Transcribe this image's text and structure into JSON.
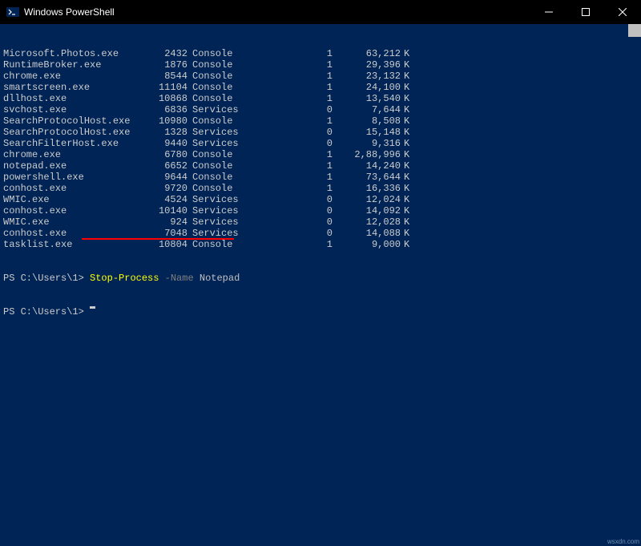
{
  "window": {
    "title": "Windows PowerShell"
  },
  "processes": [
    {
      "name": "Microsoft.Photos.exe",
      "pid": "2432",
      "session": "Console",
      "snum": "1",
      "mem": "63,212",
      "unit": "K"
    },
    {
      "name": "RuntimeBroker.exe",
      "pid": "1876",
      "session": "Console",
      "snum": "1",
      "mem": "29,396",
      "unit": "K"
    },
    {
      "name": "chrome.exe",
      "pid": "8544",
      "session": "Console",
      "snum": "1",
      "mem": "23,132",
      "unit": "K"
    },
    {
      "name": "smartscreen.exe",
      "pid": "11104",
      "session": "Console",
      "snum": "1",
      "mem": "24,100",
      "unit": "K"
    },
    {
      "name": "dllhost.exe",
      "pid": "10868",
      "session": "Console",
      "snum": "1",
      "mem": "13,540",
      "unit": "K"
    },
    {
      "name": "svchost.exe",
      "pid": "6836",
      "session": "Services",
      "snum": "0",
      "mem": "7,644",
      "unit": "K"
    },
    {
      "name": "SearchProtocolHost.exe",
      "pid": "10980",
      "session": "Console",
      "snum": "1",
      "mem": "8,508",
      "unit": "K"
    },
    {
      "name": "SearchProtocolHost.exe",
      "pid": "1328",
      "session": "Services",
      "snum": "0",
      "mem": "15,148",
      "unit": "K"
    },
    {
      "name": "SearchFilterHost.exe",
      "pid": "9440",
      "session": "Services",
      "snum": "0",
      "mem": "9,316",
      "unit": "K"
    },
    {
      "name": "chrome.exe",
      "pid": "6780",
      "session": "Console",
      "snum": "1",
      "mem": "2,88,996",
      "unit": "K"
    },
    {
      "name": "notepad.exe",
      "pid": "6652",
      "session": "Console",
      "snum": "1",
      "mem": "14,240",
      "unit": "K"
    },
    {
      "name": "powershell.exe",
      "pid": "9644",
      "session": "Console",
      "snum": "1",
      "mem": "73,644",
      "unit": "K"
    },
    {
      "name": "conhost.exe",
      "pid": "9720",
      "session": "Console",
      "snum": "1",
      "mem": "16,336",
      "unit": "K"
    },
    {
      "name": "WMIC.exe",
      "pid": "4524",
      "session": "Services",
      "snum": "0",
      "mem": "12,024",
      "unit": "K"
    },
    {
      "name": "conhost.exe",
      "pid": "10140",
      "session": "Services",
      "snum": "0",
      "mem": "14,092",
      "unit": "K"
    },
    {
      "name": "WMIC.exe",
      "pid": "924",
      "session": "Services",
      "snum": "0",
      "mem": "12,028",
      "unit": "K"
    },
    {
      "name": "conhost.exe",
      "pid": "7048",
      "session": "Services",
      "snum": "0",
      "mem": "14,088",
      "unit": "K"
    },
    {
      "name": "tasklist.exe",
      "pid": "10804",
      "session": "Console",
      "snum": "1",
      "mem": "9,000",
      "unit": "K"
    }
  ],
  "prompt1": {
    "prefix": "PS C:\\Users\\1> ",
    "cmd": "Stop-Process",
    "flag": " -Name ",
    "arg": "Notepad"
  },
  "prompt2": {
    "prefix": "PS C:\\Users\\1> "
  },
  "watermark": "wsxdn.com"
}
